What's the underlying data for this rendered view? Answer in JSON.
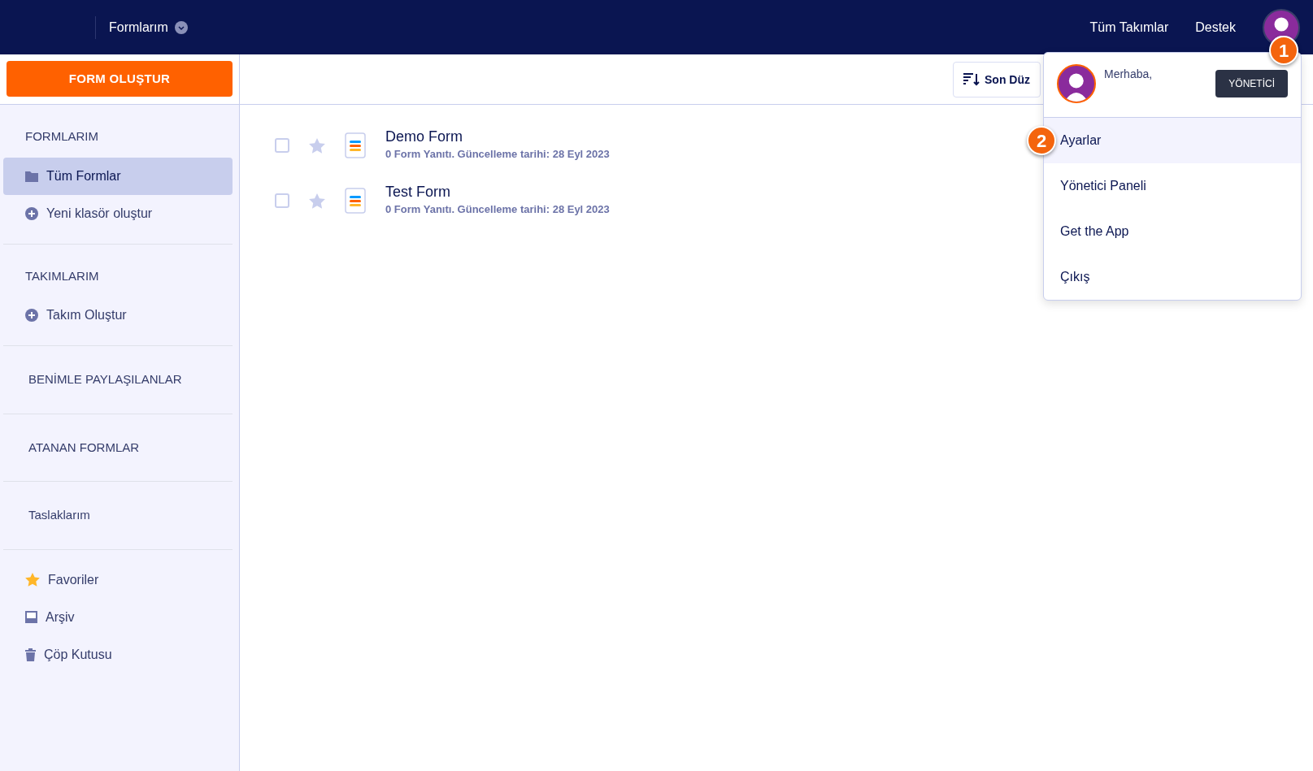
{
  "header": {
    "menu_label": "Formlarım",
    "links": [
      "Tüm Takımlar",
      "Destek"
    ]
  },
  "sidebar": {
    "create_button": "FORM OLUŞTUR",
    "sections": [
      {
        "kind": "group",
        "title": "FORMLARIM",
        "items": [
          {
            "kind": "folder",
            "label": "Tüm Formlar",
            "selected": true
          },
          {
            "kind": "add",
            "label": "Yeni klasör oluştur",
            "selected": false
          }
        ]
      },
      {
        "kind": "group",
        "title": "TAKIMLARIM",
        "items": [
          {
            "kind": "add",
            "label": "Takım Oluştur",
            "selected": false
          }
        ]
      },
      {
        "kind": "heading",
        "title": "BENİMLE PAYLAŞILANLAR"
      },
      {
        "kind": "heading",
        "title": "ATANAN FORMLAR"
      },
      {
        "kind": "link",
        "title": "Taslaklarım"
      },
      {
        "kind": "group",
        "items": [
          {
            "kind": "star",
            "label": "Favoriler",
            "selected": false
          },
          {
            "kind": "archive",
            "label": "Arşiv",
            "selected": false
          },
          {
            "kind": "trash",
            "label": "Çöp Kutusu",
            "selected": false
          }
        ]
      }
    ]
  },
  "toolbar": {
    "sort_button": "Son Düz"
  },
  "forms": [
    {
      "title": "Demo Form",
      "meta": "0 Form Yanıtı. Güncelleme tarihi: 28 Eyl 2023",
      "checked": false,
      "starred": false
    },
    {
      "title": "Test Form",
      "meta": "0 Form Yanıtı. Güncelleme tarihi: 28 Eyl 2023",
      "checked": false,
      "starred": false
    }
  ],
  "account_menu": {
    "greeting": "Merhaba,",
    "role_badge": "YÖNETİCİ",
    "items": [
      {
        "label": "Ayarlar",
        "selected": true
      },
      {
        "label": "Yönetici Paneli",
        "selected": false
      },
      {
        "label": "Get the App",
        "selected": false
      },
      {
        "label": "Çıkış",
        "selected": false
      }
    ]
  },
  "callouts": [
    "1",
    "2"
  ]
}
